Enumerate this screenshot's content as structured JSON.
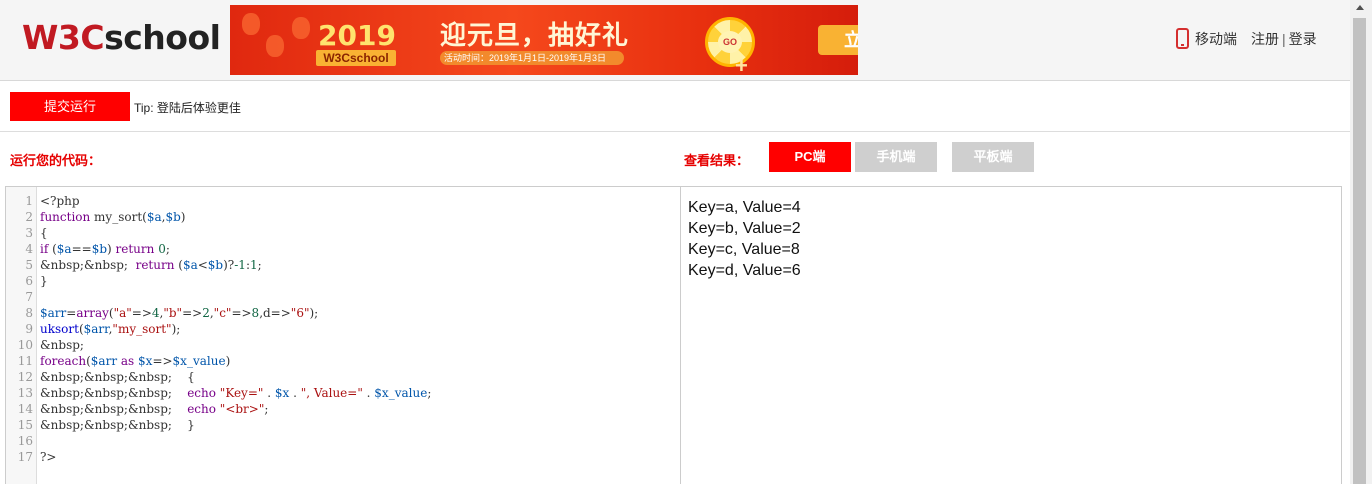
{
  "header": {
    "logo_prefix": "W3C",
    "logo_suffix": "school",
    "banner": {
      "year": "2019",
      "brand": "W3Cschool",
      "title": "迎元旦，抽好礼",
      "date": "活动时间：2019年1月1日-2019年1月3日",
      "wheel_label": "GO",
      "cta": "立"
    },
    "nav": {
      "mobile": "移动端",
      "register": "注册",
      "separator": "|",
      "login": "登录"
    }
  },
  "toolbar": {
    "run_label": "提交运行",
    "tip": "Tip: 登陆后体验更佳"
  },
  "labels": {
    "run_code": "运行您的代码：",
    "view_result": "查看结果："
  },
  "view_buttons": {
    "pc": "PC端",
    "mobile": "手机端",
    "tablet": "平板端"
  },
  "editor": {
    "lines": [
      {
        "n": "1",
        "tokens": [
          {
            "t": "<?php",
            "c": "lc"
          }
        ]
      },
      {
        "n": "2",
        "tokens": [
          {
            "t": "function",
            "c": "kw"
          },
          {
            "t": " my_sort(",
            "c": "lc"
          },
          {
            "t": "$a",
            "c": "vr"
          },
          {
            "t": ",",
            "c": "lc"
          },
          {
            "t": "$b",
            "c": "vr"
          },
          {
            "t": ")",
            "c": "lc"
          }
        ]
      },
      {
        "n": "3",
        "tokens": [
          {
            "t": "{",
            "c": "lc"
          }
        ]
      },
      {
        "n": "4",
        "tokens": [
          {
            "t": "if",
            "c": "kw"
          },
          {
            "t": " (",
            "c": "lc"
          },
          {
            "t": "$a",
            "c": "vr"
          },
          {
            "t": "==",
            "c": "lc"
          },
          {
            "t": "$b",
            "c": "vr"
          },
          {
            "t": ") ",
            "c": "lc"
          },
          {
            "t": "return",
            "c": "kw"
          },
          {
            "t": " ",
            "c": "lc"
          },
          {
            "t": "0",
            "c": "nm"
          },
          {
            "t": ";",
            "c": "lc"
          }
        ]
      },
      {
        "n": "5",
        "tokens": [
          {
            "t": "&nbsp;&nbsp;  ",
            "c": "lc"
          },
          {
            "t": "return",
            "c": "kw"
          },
          {
            "t": " (",
            "c": "lc"
          },
          {
            "t": "$a",
            "c": "vr"
          },
          {
            "t": "<",
            "c": "lc"
          },
          {
            "t": "$b",
            "c": "vr"
          },
          {
            "t": ")?",
            "c": "lc"
          },
          {
            "t": "-1",
            "c": "nm"
          },
          {
            "t": ":",
            "c": "lc"
          },
          {
            "t": "1",
            "c": "nm"
          },
          {
            "t": ";",
            "c": "lc"
          }
        ]
      },
      {
        "n": "6",
        "tokens": [
          {
            "t": "}",
            "c": "lc"
          }
        ]
      },
      {
        "n": "7",
        "tokens": []
      },
      {
        "n": "8",
        "tokens": [
          {
            "t": "$arr",
            "c": "vr"
          },
          {
            "t": "=",
            "c": "lc"
          },
          {
            "t": "array",
            "c": "kw"
          },
          {
            "t": "(",
            "c": "lc"
          },
          {
            "t": "\"a\"",
            "c": "st"
          },
          {
            "t": "=>",
            "c": "lc"
          },
          {
            "t": "4",
            "c": "nm"
          },
          {
            "t": ",",
            "c": "lc"
          },
          {
            "t": "\"b\"",
            "c": "st"
          },
          {
            "t": "=>",
            "c": "lc"
          },
          {
            "t": "2",
            "c": "nm"
          },
          {
            "t": ",",
            "c": "lc"
          },
          {
            "t": "\"c\"",
            "c": "st"
          },
          {
            "t": "=>",
            "c": "lc"
          },
          {
            "t": "8",
            "c": "nm"
          },
          {
            "t": ",d=>",
            "c": "lc"
          },
          {
            "t": "\"6\"",
            "c": "st"
          },
          {
            "t": ");",
            "c": "lc"
          }
        ]
      },
      {
        "n": "9",
        "tokens": [
          {
            "t": "uksort",
            "c": "fn"
          },
          {
            "t": "(",
            "c": "lc"
          },
          {
            "t": "$arr",
            "c": "vr"
          },
          {
            "t": ",",
            "c": "lc"
          },
          {
            "t": "\"my_sort\"",
            "c": "st"
          },
          {
            "t": ");",
            "c": "lc"
          }
        ]
      },
      {
        "n": "10",
        "tokens": [
          {
            "t": "&nbsp;",
            "c": "lc"
          }
        ]
      },
      {
        "n": "11",
        "tokens": [
          {
            "t": "foreach",
            "c": "kw"
          },
          {
            "t": "(",
            "c": "lc"
          },
          {
            "t": "$arr",
            "c": "vr"
          },
          {
            "t": " ",
            "c": "lc"
          },
          {
            "t": "as",
            "c": "kw"
          },
          {
            "t": " ",
            "c": "lc"
          },
          {
            "t": "$x",
            "c": "vr"
          },
          {
            "t": "=>",
            "c": "lc"
          },
          {
            "t": "$x_value",
            "c": "vr"
          },
          {
            "t": ")",
            "c": "lc"
          }
        ]
      },
      {
        "n": "12",
        "tokens": [
          {
            "t": "&nbsp;&nbsp;&nbsp;    {",
            "c": "lc"
          }
        ]
      },
      {
        "n": "13",
        "tokens": [
          {
            "t": "&nbsp;&nbsp;&nbsp;    ",
            "c": "lc"
          },
          {
            "t": "echo",
            "c": "kw"
          },
          {
            "t": " ",
            "c": "lc"
          },
          {
            "t": "\"Key=\"",
            "c": "st"
          },
          {
            "t": " . ",
            "c": "lc"
          },
          {
            "t": "$x",
            "c": "vr"
          },
          {
            "t": " . ",
            "c": "lc"
          },
          {
            "t": "\", Value=\"",
            "c": "st"
          },
          {
            "t": " . ",
            "c": "lc"
          },
          {
            "t": "$x_value",
            "c": "vr"
          },
          {
            "t": ";",
            "c": "lc"
          }
        ]
      },
      {
        "n": "14",
        "tokens": [
          {
            "t": "&nbsp;&nbsp;&nbsp;    ",
            "c": "lc"
          },
          {
            "t": "echo",
            "c": "kw"
          },
          {
            "t": " ",
            "c": "lc"
          },
          {
            "t": "\"<br>\"",
            "c": "st"
          },
          {
            "t": ";",
            "c": "lc"
          }
        ]
      },
      {
        "n": "15",
        "tokens": [
          {
            "t": "&nbsp;&nbsp;&nbsp;    }",
            "c": "lc"
          }
        ]
      },
      {
        "n": "16",
        "tokens": []
      },
      {
        "n": "17",
        "tokens": [
          {
            "t": "?>",
            "c": "lc"
          }
        ]
      }
    ]
  },
  "output": {
    "lines": [
      "Key=a, Value=4",
      "Key=b, Value=2",
      "Key=c, Value=8",
      "Key=d, Value=6"
    ]
  },
  "icons": {
    "mobile": "phone-icon"
  },
  "colors": {
    "accent": "#ff0000",
    "inactive_button": "#cfcfcf",
    "logo_red": "#c11a22"
  }
}
